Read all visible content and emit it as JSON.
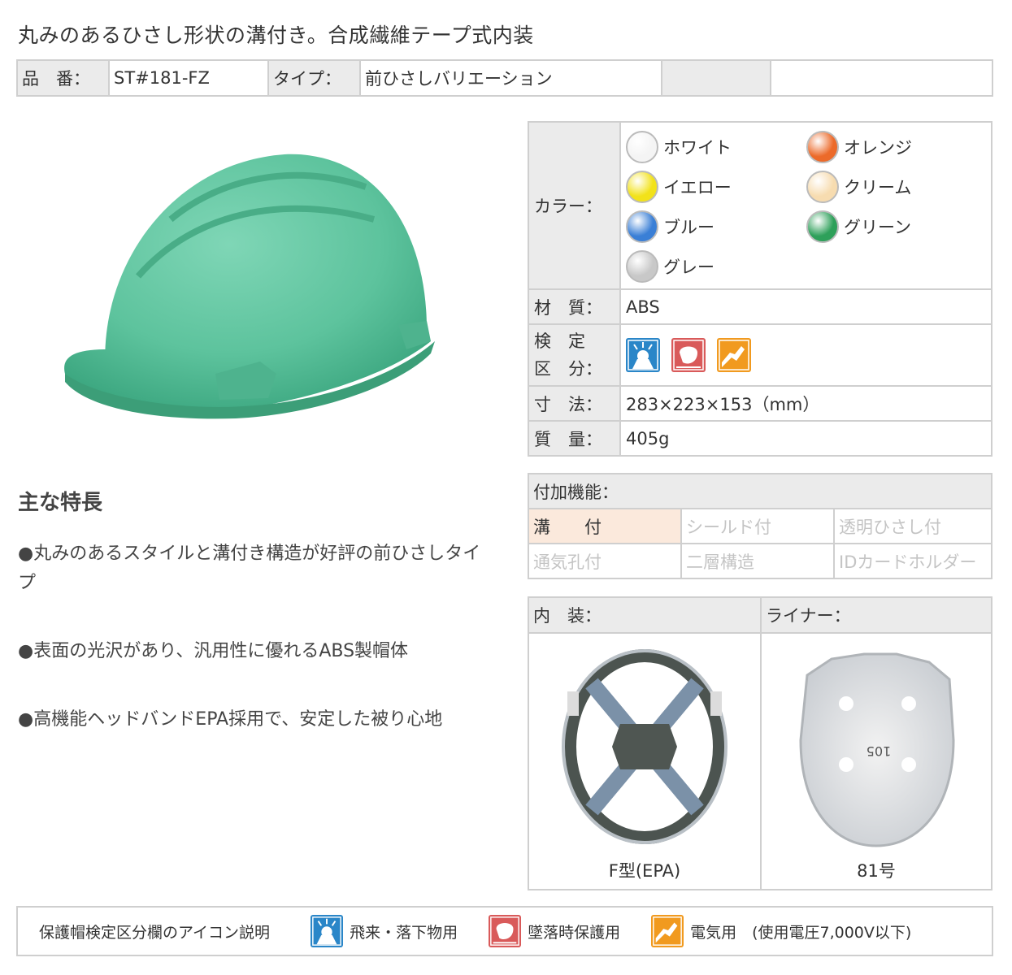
{
  "title": "丸みのあるひさし形状の溝付き。合成繊維テープ式内装",
  "spec_top": {
    "part_label": "品　番：",
    "part_value": "ST#181-FZ",
    "type_label": "タイプ：",
    "type_value": "前ひさしバリエーション"
  },
  "features": {
    "title": "主な特長",
    "items": [
      "●丸みのあるスタイルと溝付き構造が好評の前ひさしタイプ",
      "●表面の光沢があり、汎用性に優れるABS製帽体",
      "●高機能ヘッドバンドEPA採用で、安定した被り心地"
    ]
  },
  "spec": {
    "color_label": "カラー：",
    "colors": [
      {
        "name": "ホワイト",
        "hex": "#f4f4f4"
      },
      {
        "name": "オレンジ",
        "hex": "#ec6a2a"
      },
      {
        "name": "イエロー",
        "hex": "#f2e21a"
      },
      {
        "name": "クリーム",
        "hex": "#f7dcb0"
      },
      {
        "name": "ブルー",
        "hex": "#3a7fd6"
      },
      {
        "name": "グリーン",
        "hex": "#2ea05a"
      },
      {
        "name": "グレー",
        "hex": "#c8c8c8"
      }
    ],
    "material_label": "材　質：",
    "material_value": "ABS",
    "cert_label_1": "検　定",
    "cert_label_2": "区　分：",
    "size_label": "寸　法：",
    "size_value": "283×223×153（mm）",
    "weight_label": "質　量：",
    "weight_value": "405g"
  },
  "options": {
    "header": "付加機能：",
    "items": [
      {
        "label": "溝　　付",
        "active": true
      },
      {
        "label": "シールド付",
        "active": false
      },
      {
        "label": "透明ひさし付",
        "active": false
      },
      {
        "label": "通気孔付",
        "active": false
      },
      {
        "label": "二層構造",
        "active": false
      },
      {
        "label": "IDカードホルダー",
        "active": false
      }
    ]
  },
  "inner": {
    "inner_label": "内　装：",
    "liner_label": "ライナー：",
    "inner_caption": "F型(EPA)",
    "liner_caption": "81号",
    "liner_stamp": "105"
  },
  "legend": {
    "title": "保護帽検定区分欄のアイコン説明",
    "items": [
      {
        "label": "飛来・落下物用",
        "icon": "falling-object-icon",
        "color": "#2a86c8"
      },
      {
        "label": "墜落時保護用",
        "icon": "fall-protection-icon",
        "color": "#d95a5a"
      },
      {
        "label": "電気用　(使用電圧7,000V以下)",
        "icon": "electric-icon",
        "color": "#f19a1f"
      }
    ]
  }
}
